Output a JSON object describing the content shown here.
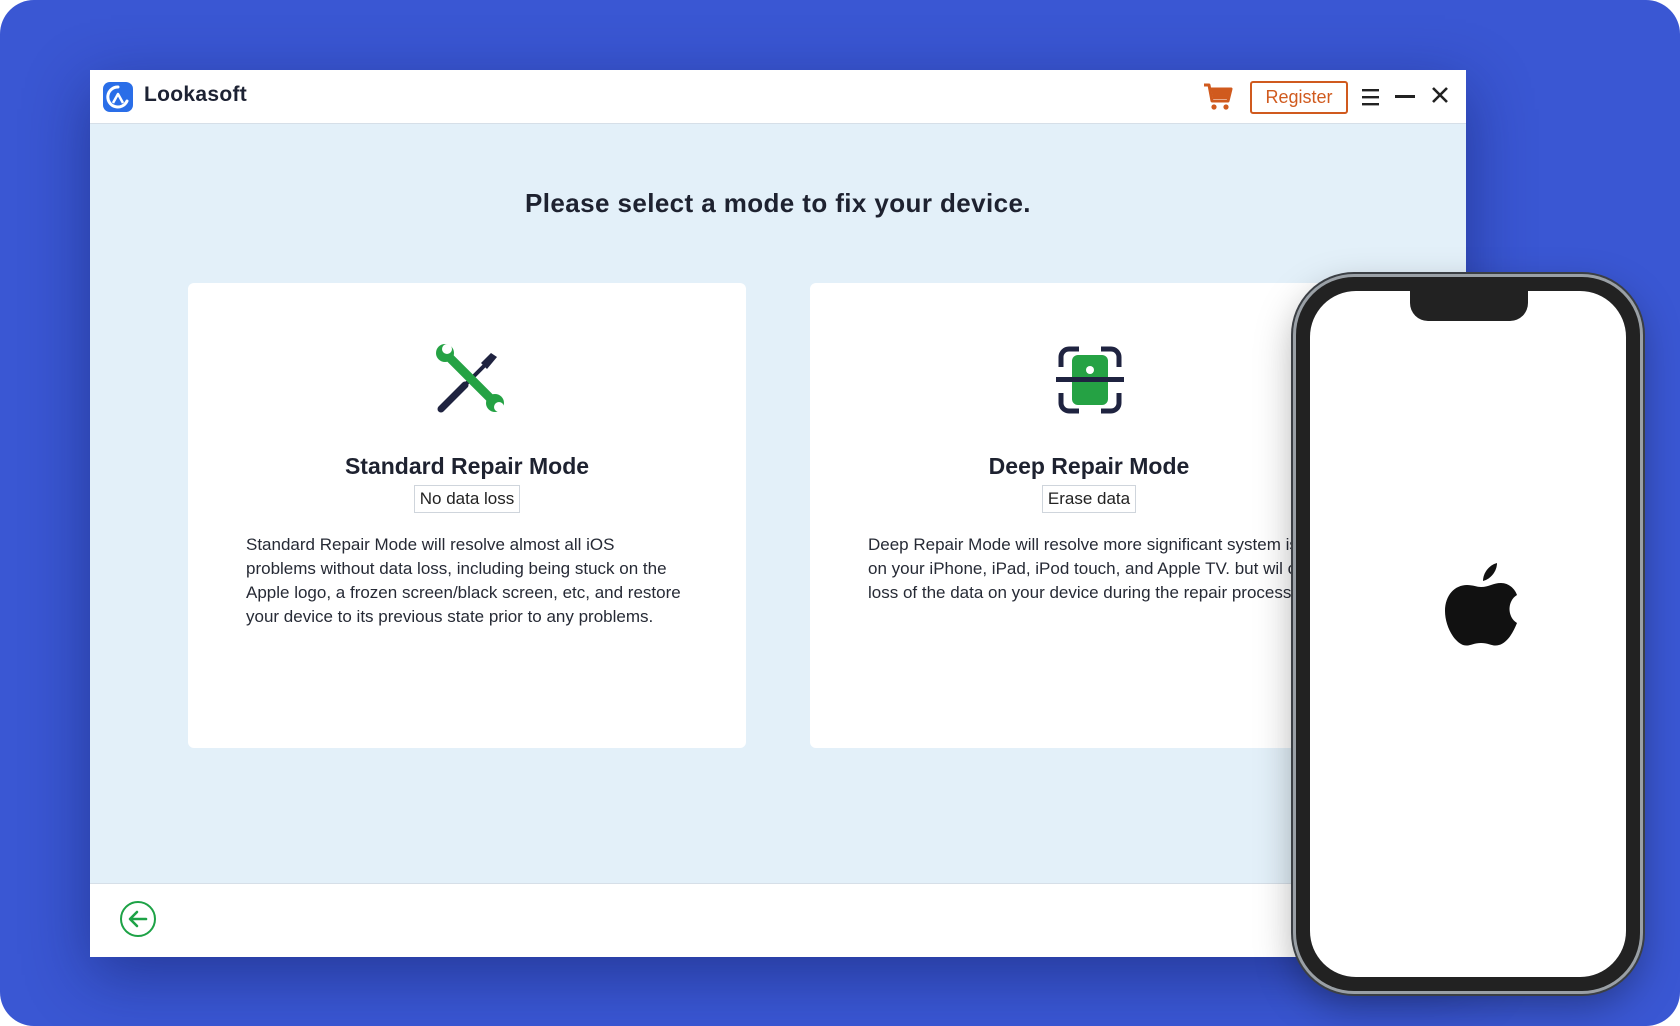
{
  "app": {
    "name": "Lookasoft",
    "register_label": "Register"
  },
  "main": {
    "heading": "Please select a mode to fix your device."
  },
  "modes": [
    {
      "title": "Standard Repair Mode",
      "badge": "No data loss",
      "description": "Standard Repair Mode will resolve almost all iOS problems without data loss, including being stuck on the Apple logo, a frozen screen/black screen, etc, and restore your device to its previous state prior to any problems."
    },
    {
      "title": "Deep Repair Mode",
      "badge": "Erase data",
      "description": "Deep Repair Mode will resolve more significant system issues on your iPhone, iPad, iPod touch, and Apple TV. but wil cause loss of the data on your device during the repair process."
    }
  ],
  "icons": {
    "logo": "lookasoft-logo-icon",
    "cart": "cart-icon",
    "menu": "menu-icon",
    "minimize": "minimize-icon",
    "close": "close-icon",
    "standard": "wrench-screwdriver-icon",
    "deep": "phone-scan-icon",
    "back": "back-arrow-icon",
    "apple": "apple-logo-icon"
  },
  "colors": {
    "background": "#3a57d3",
    "accent_orange": "#d05a1e",
    "accent_green": "#1da246",
    "window_bg": "#e3f0f9"
  }
}
